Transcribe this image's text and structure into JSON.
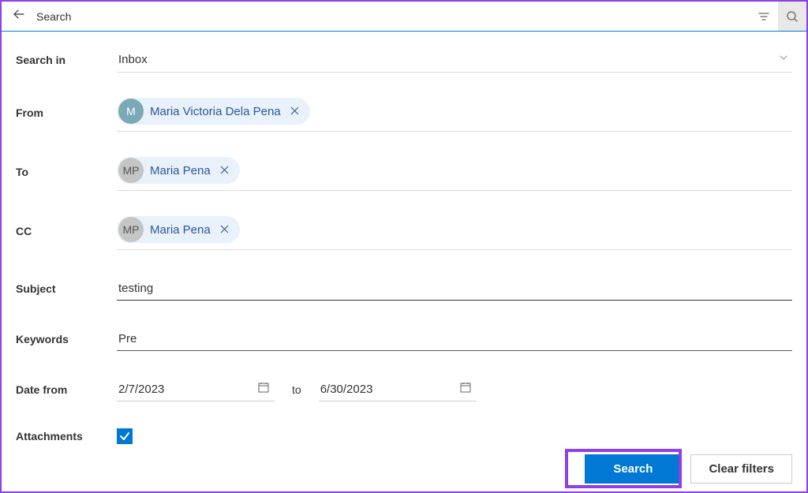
{
  "header": {
    "title": "Search"
  },
  "form": {
    "search_in": {
      "label": "Search in",
      "value": "Inbox"
    },
    "from": {
      "label": "From",
      "chips": [
        {
          "initials": "M",
          "name": "Maria Victoria Dela Pena",
          "color": "teal"
        }
      ]
    },
    "to": {
      "label": "To",
      "chips": [
        {
          "initials": "MP",
          "name": "Maria Pena",
          "color": "gray"
        }
      ]
    },
    "cc": {
      "label": "CC",
      "chips": [
        {
          "initials": "MP",
          "name": "Maria Pena",
          "color": "gray"
        }
      ]
    },
    "subject": {
      "label": "Subject",
      "value": "testing"
    },
    "keywords": {
      "label": "Keywords",
      "value": "Pre"
    },
    "date_from": {
      "label": "Date from",
      "start": "2/7/2023",
      "to_label": "to",
      "end": "6/30/2023"
    },
    "attachments": {
      "label": "Attachments",
      "checked": true
    }
  },
  "buttons": {
    "search": "Search",
    "clear": "Clear filters"
  }
}
